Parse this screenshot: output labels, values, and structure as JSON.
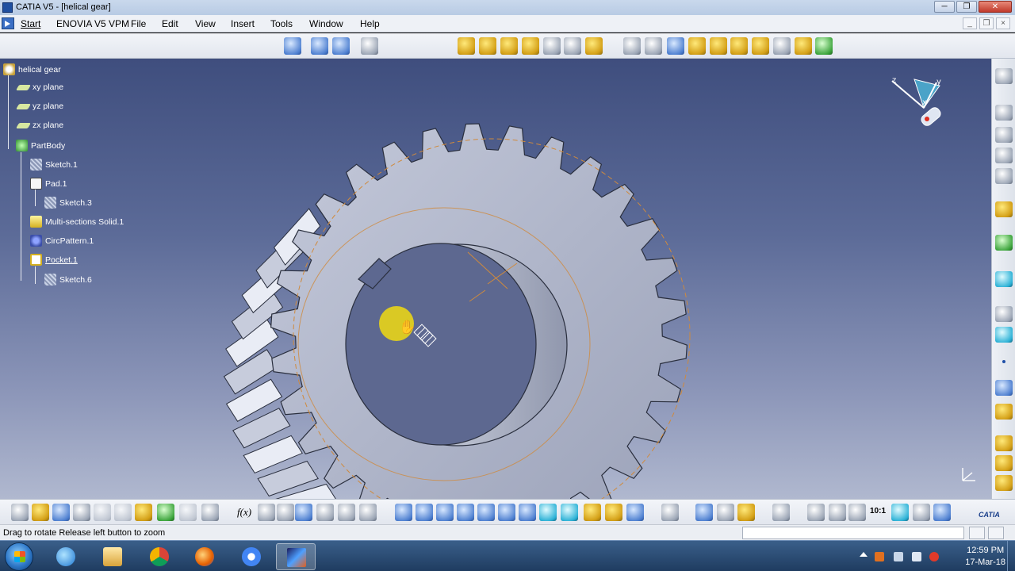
{
  "window": {
    "title": "CATIA V5 - [helical gear]",
    "controls": [
      "minimize-icon",
      "restore-icon",
      "close-icon"
    ]
  },
  "menu": {
    "items": [
      "Start",
      "ENOVIA V5 VPM",
      "File",
      "Edit",
      "View",
      "Insert",
      "Tools",
      "Window",
      "Help"
    ]
  },
  "tree": {
    "root": "helical gear",
    "nodes": [
      "xy plane",
      "yz plane",
      "zx plane",
      "PartBody",
      "Sketch.1",
      "Pad.1",
      "Sketch.3",
      "Multi-sections Solid.1",
      "CircPattern.1",
      "Pocket.1",
      "Sketch.6"
    ]
  },
  "compass": {
    "labels": [
      "z",
      "y",
      "x"
    ]
  },
  "status": {
    "message": "Drag to rotate  Release left button to zoom",
    "command_value": ""
  },
  "toolbar_bottom": {
    "fx_label": "f(x)",
    "scale_label": "10:1"
  },
  "taskbar": {
    "time": "12:59 PM",
    "date": "17-Mar-18",
    "apps": [
      "windows-explorer",
      "internet-explorer",
      "file-explorer",
      "chrome",
      "firefox",
      "chrome-alt",
      "catia"
    ]
  },
  "logo": "CATIA",
  "colors": {
    "viewport_top": "#3f4e7e",
    "viewport_bottom": "#b0b8cf",
    "gear_face": "#aeb4c8",
    "construction_line": "#d08a3c",
    "cursor_highlight": "#e8d418"
  }
}
